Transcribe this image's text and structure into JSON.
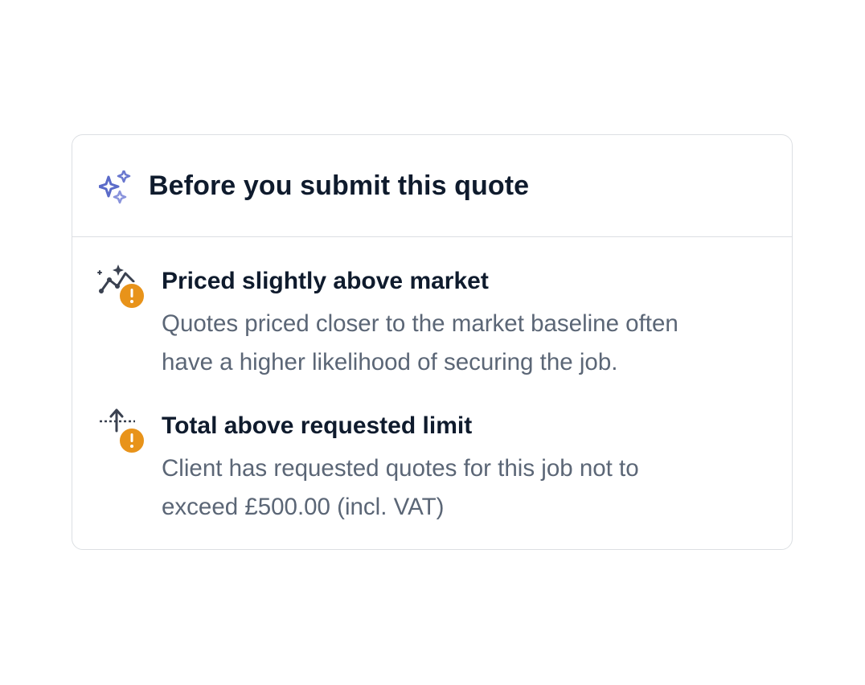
{
  "card": {
    "title": "Before you submit this quote",
    "icon": "sparkles-icon"
  },
  "alerts": [
    {
      "icon": "chart-trend-icon",
      "badge_icon": "warning-icon",
      "badge_color": "#e8931a",
      "title": "Priced slightly above market",
      "body_line_1": "Quotes priced closer to the market baseline often",
      "body_line_2": "have a higher likelihood of securing the job."
    },
    {
      "icon": "limit-arrow-icon",
      "badge_icon": "warning-icon",
      "badge_color": "#e8931a",
      "title": "Total above requested limit",
      "body_line_1": "Client has requested quotes for this job not to",
      "body_line_2": "exceed £500.00 (incl. VAT)"
    }
  ],
  "colors": {
    "accent": "#5b6bc9",
    "warning": "#e8931a",
    "text_primary": "#0f1b2d",
    "text_secondary": "#5b6676",
    "border": "#dcdfe3"
  }
}
